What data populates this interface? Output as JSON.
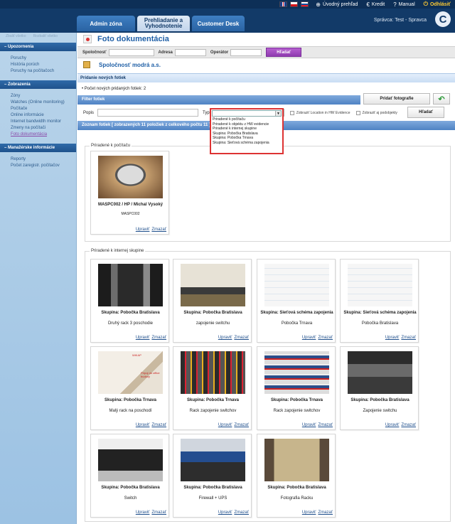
{
  "topbar": {
    "languages": [
      "EN",
      "CZ",
      "SK"
    ],
    "links": [
      {
        "icon": "globe-icon",
        "label": "Úvodný prehľad"
      },
      {
        "icon": "euro-icon",
        "label": "Kredit"
      },
      {
        "icon": "help-icon",
        "label": "Manual"
      },
      {
        "icon": "power-icon",
        "label": "Odhlásiť"
      }
    ],
    "tabs": [
      {
        "label": "Admin zóna"
      },
      {
        "label": "Prehliadanie a Vyhodnotenie"
      },
      {
        "label": "Customer Desk"
      }
    ],
    "active_tab": "Prehliadanie a Vyhodnotenie",
    "user": "Správca: Test - Spravca"
  },
  "sidebar": {
    "top_links": [
      "Zbaliť všetko",
      "Rozbaliť všetko"
    ],
    "sections": [
      {
        "title": "Upozornenia",
        "items": [
          "Poruchy",
          "História porúch",
          "Poruchy na počítačoch"
        ]
      },
      {
        "title": "Zobrazenia",
        "items": [
          "Zóny",
          "Watches (Online monitoring)",
          "Počítače",
          "Online informácie",
          "Internet bandwidth monitor",
          "Zmeny na počítači",
          "Foto dokumentácia"
        ]
      },
      {
        "title": "Manažérske informácie",
        "items": [
          "Reporty",
          "Počet zaregistr. počítačov"
        ]
      }
    ],
    "current_item": "Foto dokumentácia"
  },
  "main": {
    "title": "Foto dokumentácia",
    "search": {
      "company_label": "Spoločnosť",
      "address_label": "Adresa",
      "operator_label": "Operátor",
      "company_value": "",
      "address_value": "",
      "operator_value": "",
      "button": "Hľadať"
    },
    "company_name": "Spoločnosť modrá a.s.",
    "add_section": "Pridanie nových fotiek",
    "new_count": "Počet nových pridaných fotiek: 2",
    "filter_section": "Filter fotiek",
    "add_photo_button": "Pridať fotografie",
    "filter": {
      "description_label": "Popis",
      "type_label": "Typ",
      "type_value": "",
      "show_location_label": "Zobraziť Location in HW Evidence",
      "show_subobjects_label": "Zobraziť aj podobjekty",
      "search_button": "Hľadať",
      "type_options": [
        "",
        "Priradené k počítaču",
        "Priradené k objektu z HW evidencie",
        "Priradené k internej skupine",
        "Skupina: Pobočka Bratislava",
        "Skupina: Pobočka Trnava",
        "Skupina: Sieťová schéma zapojenia"
      ]
    },
    "list_header": "Zoznam fotiek [ zobrazených 11 položiek z celkového počtu 11 ]",
    "groups": [
      {
        "legend": "Priradené k počítaču",
        "photos": [
          {
            "title": "MASPC002 / HP / Michal Vysoký",
            "desc": "MASPC002",
            "image": "monitor"
          }
        ]
      },
      {
        "legend": "Priradené k internej skupine",
        "photos": [
          {
            "title": "Skupina: Pobočka Bratislava",
            "desc": "Druhý rack 3 poschodie",
            "image": "rack"
          },
          {
            "title": "Skupina: Pobočka Bratislava",
            "desc": "zapojenie switchu",
            "image": "switch"
          },
          {
            "title": "Skupina: Sieťová schéma zapojenia",
            "desc": "Pobočka Trnava",
            "image": "diagram"
          },
          {
            "title": "Skupina: Sieťová schéma zapojenia",
            "desc": "Pobočka Bratislava",
            "image": "diagram"
          },
          {
            "title": "Skupina: Pobočka Trnava",
            "desc": "Malý rack na poschodí",
            "image": "wall",
            "annotations": [
              "Wifi AP",
              "Prípoj do office budovy"
            ]
          },
          {
            "title": "Skupina: Pobočka Trnava",
            "desc": "Rack zapojenie switchov",
            "image": "cables"
          },
          {
            "title": "Skupina: Pobočka Trnava",
            "desc": "Rack zapojenie switchov",
            "image": "panel"
          },
          {
            "title": "Skupina: Pobočka Bratislava",
            "desc": "Zapojenie switchu",
            "image": "dark"
          },
          {
            "title": "Skupina: Pobočka Bratislava",
            "desc": "Switch",
            "image": "switch2"
          },
          {
            "title": "Skupina: Pobočka Bratislava",
            "desc": "Firewall + UPS",
            "image": "fw"
          },
          {
            "title": "Skupina: Pobočka Bratislava",
            "desc": "Fotografia Racku",
            "image": "rackopen"
          }
        ]
      }
    ],
    "edit_label": "Upraviť",
    "delete_label": "Zmazať"
  }
}
